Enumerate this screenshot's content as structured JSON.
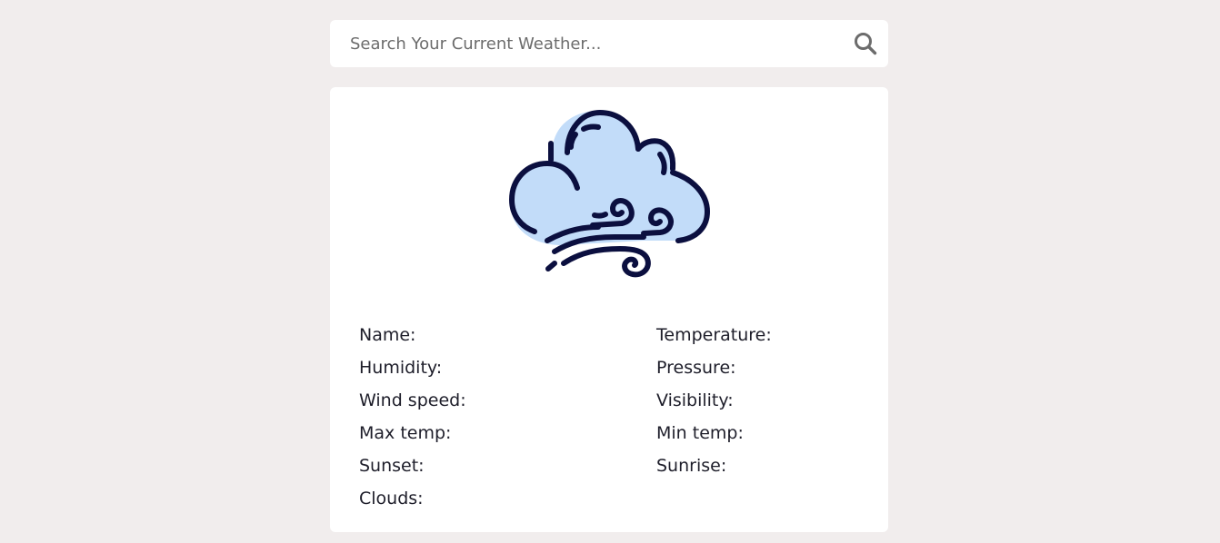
{
  "search": {
    "placeholder": "Search Your Current Weather...",
    "value": "",
    "icon": "search-icon"
  },
  "weather": {
    "icon": "cloudy-windy-icon",
    "colors": {
      "cloud_fill": "#c2dcf9",
      "stroke": "#0b0f3f"
    }
  },
  "details": {
    "name_label": "Name:",
    "temperature_label": "Temperature:",
    "humidity_label": "Humidity:",
    "pressure_label": "Pressure:",
    "wind_speed_label": "Wind speed:",
    "visibility_label": "Visibility:",
    "max_temp_label": "Max temp:",
    "min_temp_label": "Min temp:",
    "sunset_label": "Sunset:",
    "sunrise_label": "Sunrise:",
    "clouds_label": "Clouds:"
  },
  "colors": {
    "background": "#f1eded",
    "card": "#ffffff",
    "text": "#1e1e2a",
    "search_icon": "#6c6c6c"
  }
}
